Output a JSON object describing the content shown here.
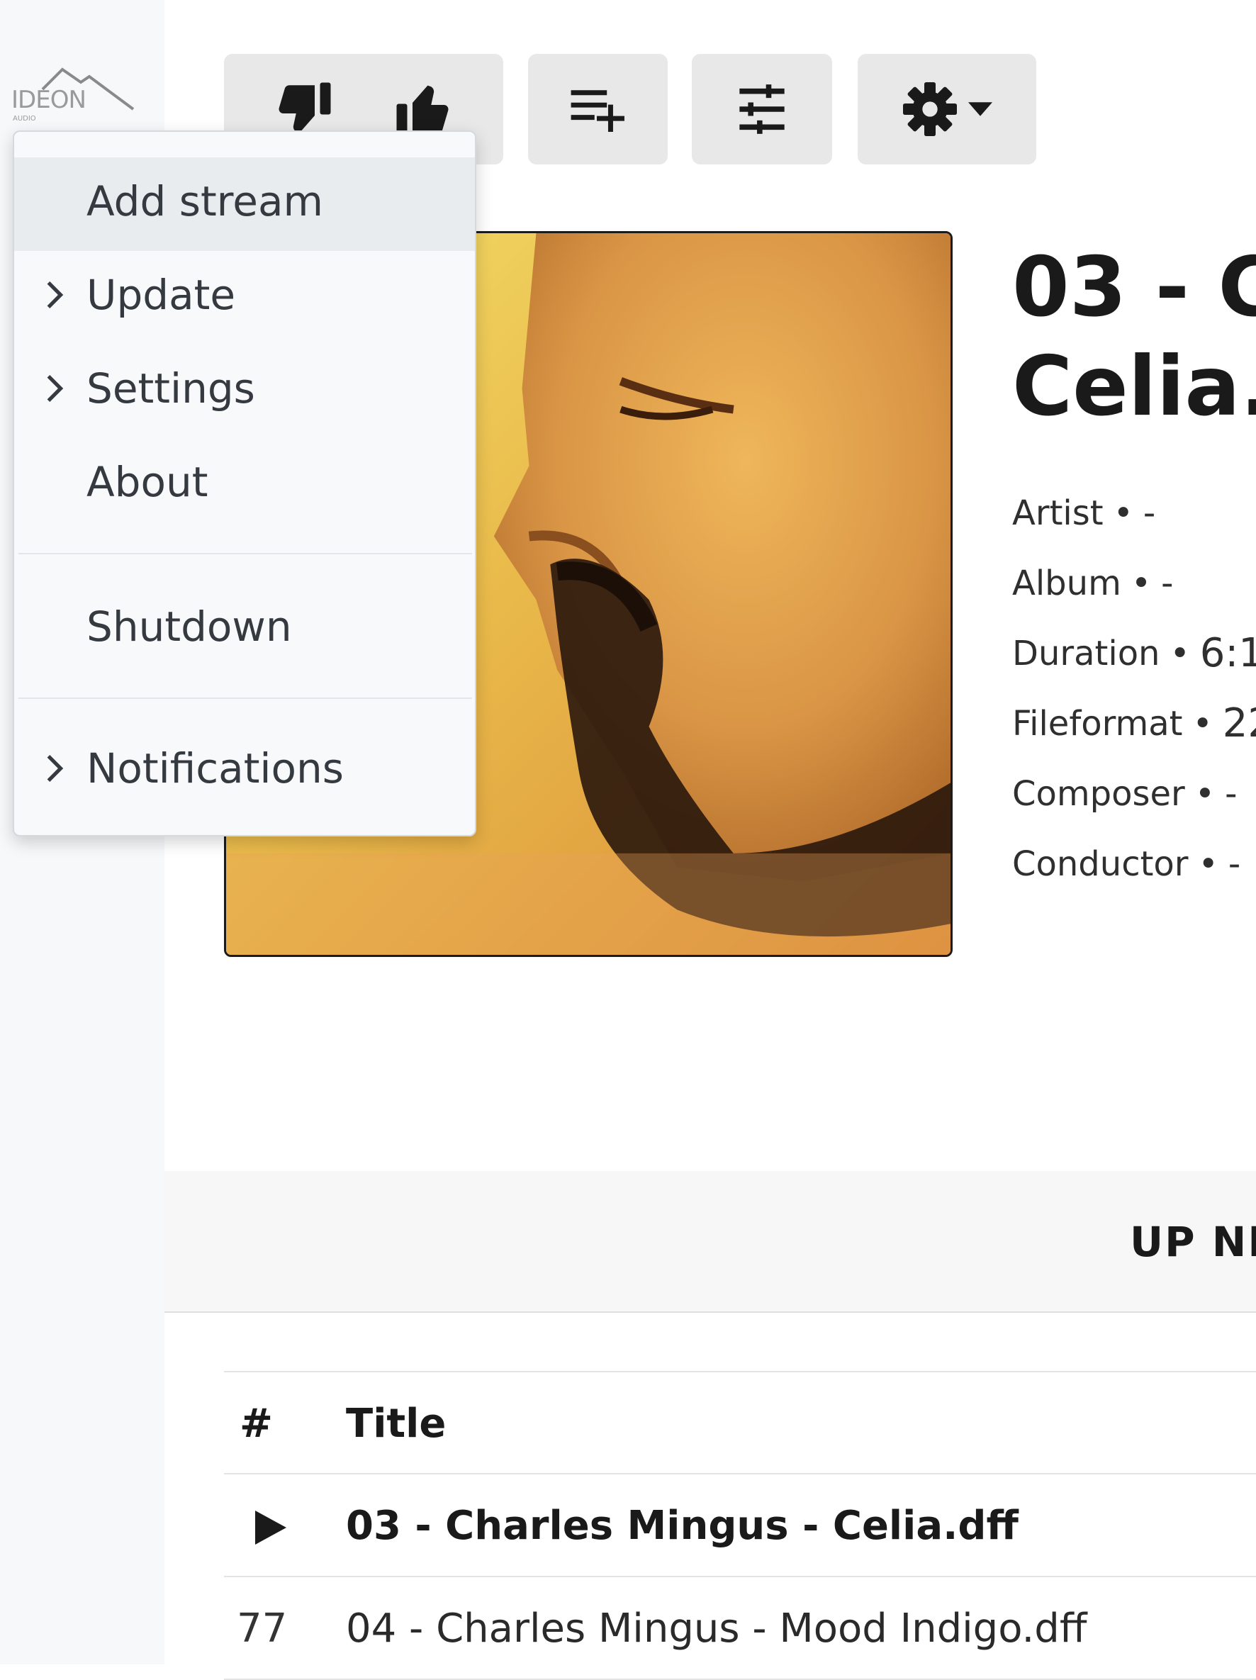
{
  "logo": {
    "text": "IDEON",
    "sub": "AUDIO"
  },
  "toolbar": {
    "dislike_icon": "thumbs-down-icon",
    "like_icon": "thumbs-up-icon",
    "queue_icon": "playlist-add-icon",
    "eq_icon": "sliders-icon",
    "settings_icon": "gear-icon",
    "settings_caret": "caret-down-icon"
  },
  "dropdown": {
    "items": [
      {
        "label": "Add stream"
      },
      {
        "label": "Update"
      },
      {
        "label": "Settings"
      },
      {
        "label": "About"
      },
      {
        "label": "Shutdown"
      },
      {
        "label": "Notifications"
      }
    ]
  },
  "track": {
    "title": "03 - C\nCelia.d",
    "meta": [
      {
        "label": "Artist",
        "value": "-"
      },
      {
        "label": "Album",
        "value": "-"
      },
      {
        "label": "Duration",
        "value": "6:1"
      },
      {
        "label": "Fileformat",
        "value": "22"
      },
      {
        "label": "Composer",
        "value": "-"
      },
      {
        "label": "Conductor",
        "value": "-"
      }
    ]
  },
  "upnext": {
    "title": "UP NE"
  },
  "queue": {
    "columns": {
      "num": "#",
      "title": "Title"
    },
    "rows": [
      {
        "num": "",
        "title": "03 - Charles Mingus - Celia.dff",
        "active": true
      },
      {
        "num": "77",
        "title": "04 - Charles Mingus - Mood Indigo.dff",
        "active": false
      }
    ]
  },
  "colors": {
    "toolbar_bg": "#e8e8e8",
    "menu_bg": "#f7f9fb",
    "menu_hover": "#e9ecef",
    "text": "#212529"
  }
}
